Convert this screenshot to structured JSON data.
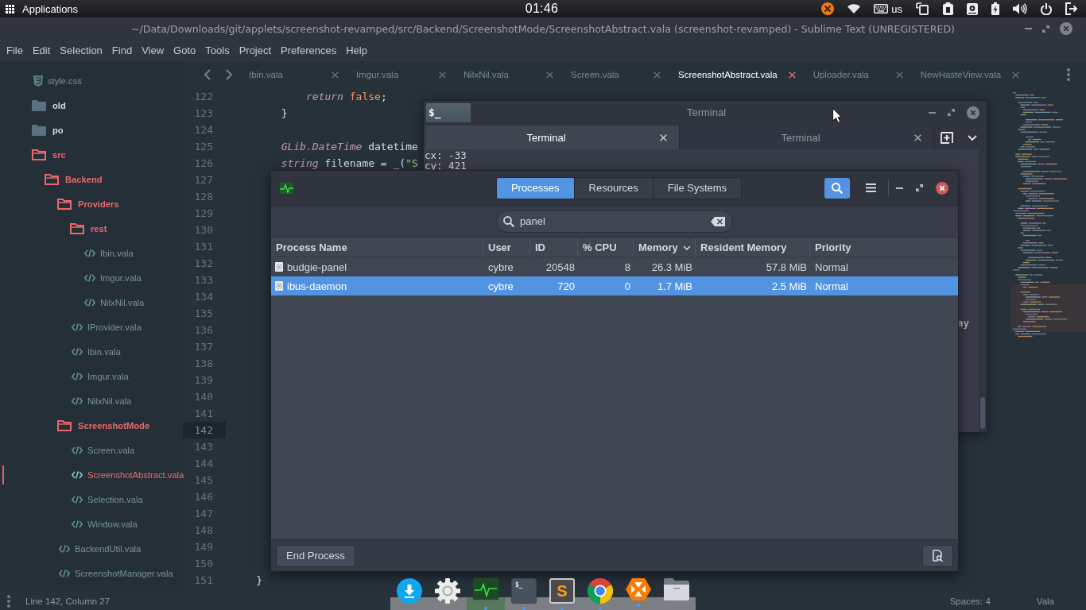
{
  "top_panel": {
    "menu_label": "Applications",
    "clock": "01:46",
    "keyboard_layout": "us"
  },
  "sublime": {
    "title": "~/Data/Downloads/git/applets/screenshot-revamped/src/Backend/ScreenshotMode/ScreenshotAbstract.vala (screenshot-revamped) - Sublime Text (UNREGISTERED)",
    "menu": [
      "File",
      "Edit",
      "Selection",
      "Find",
      "View",
      "Goto",
      "Tools",
      "Project",
      "Preferences",
      "Help"
    ],
    "sidebar": [
      {
        "name": "style.css",
        "kind": "stylesheet",
        "selected": false
      },
      {
        "name": "old",
        "kind": "folder",
        "expanded": false,
        "selected": false
      },
      {
        "name": "po",
        "kind": "folder",
        "expanded": false,
        "selected": false
      },
      {
        "name": "src",
        "kind": "folder",
        "expanded": true,
        "selected": false,
        "children": [
          {
            "name": "Backend",
            "kind": "folder",
            "expanded": true,
            "selected": false,
            "children": [
              {
                "name": "Providers",
                "kind": "folder",
                "expanded": true,
                "selected": false,
                "children": [
                  {
                    "name": "rest",
                    "kind": "folder",
                    "expanded": true,
                    "selected": false,
                    "children": [
                      {
                        "name": "Ibin.vala",
                        "kind": "source",
                        "selected": false
                      },
                      {
                        "name": "Imgur.vala",
                        "kind": "source",
                        "selected": false
                      },
                      {
                        "name": "NilxNil.vala",
                        "kind": "source",
                        "selected": false
                      }
                    ]
                  },
                  {
                    "name": "IProvider.vala",
                    "kind": "source",
                    "selected": false
                  },
                  {
                    "name": "Ibin.vala",
                    "kind": "source",
                    "selected": false
                  },
                  {
                    "name": "Imgur.vala",
                    "kind": "source",
                    "selected": false
                  },
                  {
                    "name": "NilxNil.vala",
                    "kind": "source",
                    "selected": false
                  }
                ]
              },
              {
                "name": "ScreenshotMode",
                "kind": "folder",
                "expanded": true,
                "selected": false,
                "children": [
                  {
                    "name": "Screen.vala",
                    "kind": "source",
                    "selected": false
                  },
                  {
                    "name": "ScreenshotAbstract.vala",
                    "kind": "source",
                    "selected": true
                  },
                  {
                    "name": "Selection.vala",
                    "kind": "source",
                    "selected": false
                  },
                  {
                    "name": "Window.vala",
                    "kind": "source",
                    "selected": false
                  }
                ]
              },
              {
                "name": "BackendUtil.vala",
                "kind": "source",
                "selected": false
              },
              {
                "name": "ScreenshotManager.vala",
                "kind": "source",
                "selected": false
              }
            ]
          }
        ]
      }
    ],
    "tabs": [
      {
        "label": "Ibin.vala",
        "selected": false
      },
      {
        "label": "Imgur.vala",
        "selected": false
      },
      {
        "label": "NilxNil.vala",
        "selected": false
      },
      {
        "label": "Screen.vala",
        "selected": false
      },
      {
        "label": "ScreenshotAbstract.vala",
        "selected": true
      },
      {
        "label": "Uploader.vala",
        "selected": false
      },
      {
        "label": "NewHasteView.vala",
        "selected": false
      }
    ],
    "lines": [
      {
        "number": "122",
        "current": false,
        "code": [
          {
            "kind": "keyword",
            "text": "            return"
          },
          {
            "kind": "literal",
            "text": " false"
          },
          {
            "kind": "plain",
            "text": ";"
          }
        ]
      },
      {
        "number": "123",
        "current": false,
        "code": [
          {
            "kind": "plain",
            "text": "        }"
          }
        ]
      },
      {
        "number": "124",
        "current": false
      },
      {
        "number": "125",
        "current": false,
        "code": [
          {
            "kind": "type",
            "text": "        GLib.DateTime"
          },
          {
            "kind": "plain",
            "text": " datetime"
          }
        ]
      },
      {
        "number": "126",
        "current": false,
        "code": [
          {
            "kind": "type",
            "text": "        string"
          },
          {
            "kind": "plain",
            "text": " filename = _("
          },
          {
            "kind": "string",
            "text": "\"S"
          }
        ]
      },
      {
        "number": "127",
        "current": false
      },
      {
        "number": "128",
        "current": false
      },
      {
        "number": "129",
        "current": false
      },
      {
        "number": "130",
        "current": false
      },
      {
        "number": "131",
        "current": false
      },
      {
        "number": "132",
        "current": false
      },
      {
        "number": "133",
        "current": false
      },
      {
        "number": "134",
        "current": false
      },
      {
        "number": "135",
        "current": false
      },
      {
        "number": "136",
        "current": false
      },
      {
        "number": "137",
        "current": false
      },
      {
        "number": "138",
        "current": false
      },
      {
        "number": "139",
        "current": false
      },
      {
        "number": "140",
        "current": false
      },
      {
        "number": "141",
        "current": false
      },
      {
        "number": "142",
        "current": true
      },
      {
        "number": "143",
        "current": false
      },
      {
        "number": "144",
        "current": false
      },
      {
        "number": "145",
        "current": false
      },
      {
        "number": "146",
        "current": false
      },
      {
        "number": "147",
        "current": false
      },
      {
        "number": "148",
        "current": false
      },
      {
        "number": "149",
        "current": false
      },
      {
        "number": "150",
        "current": false
      },
      {
        "number": "151",
        "current": false,
        "code": [
          {
            "kind": "plain",
            "text": "    }"
          }
        ]
      }
    ],
    "status_bar": {
      "position": "Line 142, Column 27",
      "indentation": "Spaces: 4",
      "syntax": "Vala"
    }
  },
  "terminal": {
    "app_badge": "$_",
    "title": "Terminal",
    "tabs": [
      {
        "label": "Terminal",
        "selected": true
      },
      {
        "label": "Terminal",
        "selected": false
      }
    ],
    "lines": [
      {
        "kind": "full",
        "text": "cx: -33"
      },
      {
        "kind": "full",
        "text": "cy: 421"
      },
      {
        "kind": "cut",
        "text": "ay"
      }
    ]
  },
  "system_monitor": {
    "view_tabs": [
      {
        "label": "Processes",
        "selected": true
      },
      {
        "label": "Resources",
        "selected": false
      },
      {
        "label": "File Systems",
        "selected": false
      }
    ],
    "search_toggle": {
      "on": true
    },
    "search": {
      "value": "panel"
    },
    "columns": [
      {
        "label": "Process Name",
        "numeric": false,
        "sorted": false
      },
      {
        "label": "User",
        "numeric": false,
        "sorted": false
      },
      {
        "label": "ID",
        "numeric": true,
        "sorted": false
      },
      {
        "label": "% CPU",
        "numeric": true,
        "sorted": false
      },
      {
        "label": "Memory",
        "numeric": true,
        "sorted": true
      },
      {
        "label": "Resident Memory",
        "numeric": true,
        "sorted": false
      },
      {
        "label": "Priority",
        "numeric": false,
        "sorted": false
      }
    ],
    "rows": [
      {
        "selected": false,
        "cells": [
          "budgie-panel",
          "cybre",
          "20548",
          "8",
          "26.3 MiB",
          "57.8 MiB",
          "Normal"
        ]
      },
      {
        "selected": true,
        "cells": [
          "ibus-daemon",
          "cybre",
          "720",
          "0",
          "1.7 MiB",
          "2.5 MiB",
          "Normal"
        ]
      }
    ],
    "end_button": "End Process"
  },
  "dock": {
    "items": [
      {
        "kind": "download",
        "running": false,
        "active": false
      },
      {
        "kind": "settings",
        "running": false,
        "active": false
      },
      {
        "kind": "monitor",
        "running": true,
        "active": true
      },
      {
        "kind": "terminal",
        "glyph": "$_",
        "running": true,
        "active": false
      },
      {
        "kind": "editor",
        "glyph": "S",
        "running": true,
        "active": false
      },
      {
        "kind": "browser",
        "running": true,
        "active": false
      },
      {
        "kind": "hexagon",
        "running": true,
        "active": false
      },
      {
        "kind": "files",
        "running": false,
        "active": false
      }
    ]
  }
}
